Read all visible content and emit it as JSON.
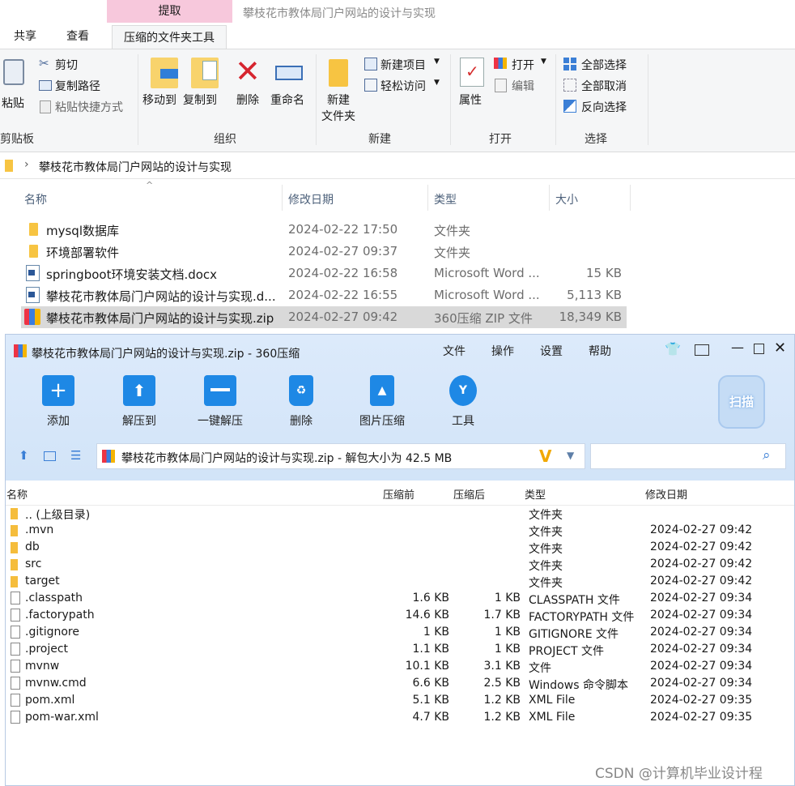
{
  "explorer": {
    "context_tab": "提取",
    "window_title": "攀枝花市教体局门户网站的设计与实现",
    "tabs": [
      "共享",
      "查看",
      "压缩的文件夹工具"
    ],
    "clipboard": {
      "paste": "粘贴",
      "cut": "剪切",
      "copy_path": "复制路径",
      "paste_shortcut": "粘贴快捷方式",
      "group": "剪贴板"
    },
    "organize": {
      "move_to": "移动到",
      "copy_to": "复制到",
      "delete": "删除",
      "rename": "重命名",
      "group": "组织"
    },
    "new": {
      "new_folder_line1": "新建",
      "new_folder_line2": "文件夹",
      "new_item": "新建项目",
      "easy_access": "轻松访问",
      "group": "新建"
    },
    "open": {
      "properties": "属性",
      "open": "打开",
      "edit": "编辑",
      "group": "打开"
    },
    "select": {
      "select_all": "全部选择",
      "select_none": "全部取消",
      "invert": "反向选择",
      "group": "选择"
    },
    "breadcrumb": "攀枝花市教体局门户网站的设计与实现",
    "columns": [
      "名称",
      "修改日期",
      "类型",
      "大小"
    ],
    "files": [
      {
        "name": "mysql数据库",
        "date": "2024-02-22 17:50",
        "type": "文件夹",
        "size": "",
        "icon": "folder-icon"
      },
      {
        "name": "环境部署软件",
        "date": "2024-02-27 09:37",
        "type": "文件夹",
        "size": "",
        "icon": "folder-icon"
      },
      {
        "name": "springboot环境安装文档.docx",
        "date": "2024-02-22 16:58",
        "type": "Microsoft Word ...",
        "size": "15 KB",
        "icon": "word-doc-icon"
      },
      {
        "name": "攀枝花市教体局门户网站的设计与实现.d...",
        "date": "2024-02-22 16:55",
        "type": "Microsoft Word ...",
        "size": "5,113 KB",
        "icon": "word-doc-icon"
      },
      {
        "name": "攀枝花市教体局门户网站的设计与实现.zip",
        "date": "2024-02-27 09:42",
        "type": "360压缩 ZIP 文件",
        "size": "18,349 KB",
        "icon": "zip-icon",
        "selected": true
      }
    ]
  },
  "zip": {
    "title": "攀枝花市教体局门户网站的设计与实现.zip - 360压缩",
    "menu": [
      "文件",
      "操作",
      "设置",
      "帮助"
    ],
    "tools": [
      "添加",
      "解压到",
      "一键解压",
      "删除",
      "图片压缩",
      "工具"
    ],
    "scan": "扫描",
    "path": "攀枝花市教体局门户网站的设计与实现.zip - 解包大小为 42.5 MB",
    "columns": [
      "名称",
      "压缩前",
      "压缩后",
      "类型",
      "修改日期"
    ],
    "rows": [
      {
        "name": ".. (上级目录)",
        "before": "",
        "after": "",
        "type": "文件夹",
        "date": "",
        "kind": "folder"
      },
      {
        "name": ".mvn",
        "before": "",
        "after": "",
        "type": "文件夹",
        "date": "2024-02-27 09:42",
        "kind": "folder"
      },
      {
        "name": "db",
        "before": "",
        "after": "",
        "type": "文件夹",
        "date": "2024-02-27 09:42",
        "kind": "folder"
      },
      {
        "name": "src",
        "before": "",
        "after": "",
        "type": "文件夹",
        "date": "2024-02-27 09:42",
        "kind": "folder"
      },
      {
        "name": "target",
        "before": "",
        "after": "",
        "type": "文件夹",
        "date": "2024-02-27 09:42",
        "kind": "folder"
      },
      {
        "name": ".classpath",
        "before": "1.6 KB",
        "after": "1 KB",
        "type": "CLASSPATH 文件",
        "date": "2024-02-27 09:34",
        "kind": "file"
      },
      {
        "name": ".factorypath",
        "before": "14.6 KB",
        "after": "1.7 KB",
        "type": "FACTORYPATH 文件",
        "date": "2024-02-27 09:34",
        "kind": "file"
      },
      {
        "name": ".gitignore",
        "before": "1 KB",
        "after": "1 KB",
        "type": "GITIGNORE 文件",
        "date": "2024-02-27 09:34",
        "kind": "file"
      },
      {
        "name": ".project",
        "before": "1.1 KB",
        "after": "1 KB",
        "type": "PROJECT 文件",
        "date": "2024-02-27 09:34",
        "kind": "file"
      },
      {
        "name": "mvnw",
        "before": "10.1 KB",
        "after": "3.1 KB",
        "type": "文件",
        "date": "2024-02-27 09:34",
        "kind": "file"
      },
      {
        "name": "mvnw.cmd",
        "before": "6.6 KB",
        "after": "2.5 KB",
        "type": "Windows 命令脚本",
        "date": "2024-02-27 09:34",
        "kind": "file"
      },
      {
        "name": "pom.xml",
        "before": "5.1 KB",
        "after": "1.2 KB",
        "type": "XML File",
        "date": "2024-02-27 09:35",
        "kind": "file"
      },
      {
        "name": "pom-war.xml",
        "before": "4.7 KB",
        "after": "1.2 KB",
        "type": "XML File",
        "date": "2024-02-27 09:35",
        "kind": "file"
      }
    ]
  },
  "watermark": "CSDN @计算机毕业设计程"
}
